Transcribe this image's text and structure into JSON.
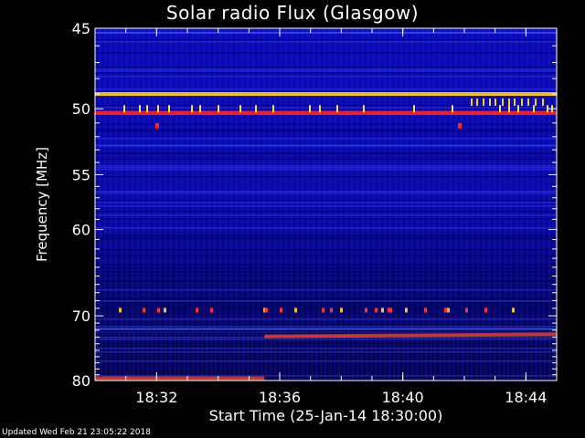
{
  "chart_data": {
    "type": "heatmap",
    "title": "Solar radio Flux (Glasgow)",
    "ylabel": "Frequency [MHz]",
    "xlabel": "Start Time (25-Jan-14 18:30:00)",
    "y_axis": {
      "range_mhz": [
        45,
        80
      ],
      "ticks": [
        "45",
        "50",
        "55",
        "60",
        "70",
        "80"
      ]
    },
    "x_axis": {
      "range": [
        "18:30:00",
        "18:45:00"
      ],
      "ticks": [
        "18:32",
        "18:36",
        "18:40",
        "18:44"
      ]
    },
    "colormap": [
      "#000033",
      "#0000aa",
      "#2233ee",
      "#ff0000",
      "#ffdd00"
    ],
    "grid": false,
    "features": [
      {
        "kind": "continuous-band",
        "freq_mhz": 49.0,
        "color": "#ffcc00"
      },
      {
        "kind": "continuous-band",
        "freq_mhz": 50.3,
        "color": "#ff2020"
      },
      {
        "kind": "step-line",
        "segments": [
          {
            "t_start": "18:30:00",
            "t_end": "18:35:30",
            "freq_mhz": 79.6
          },
          {
            "t_start": "18:35:30",
            "t_end": "18:45:00",
            "freq_mhz": 72.9,
            "freq_end_mhz": 72.6
          }
        ],
        "color": "#ff2020"
      }
    ]
  },
  "footer": "Updated Wed Feb 21 23:05:22 2018"
}
